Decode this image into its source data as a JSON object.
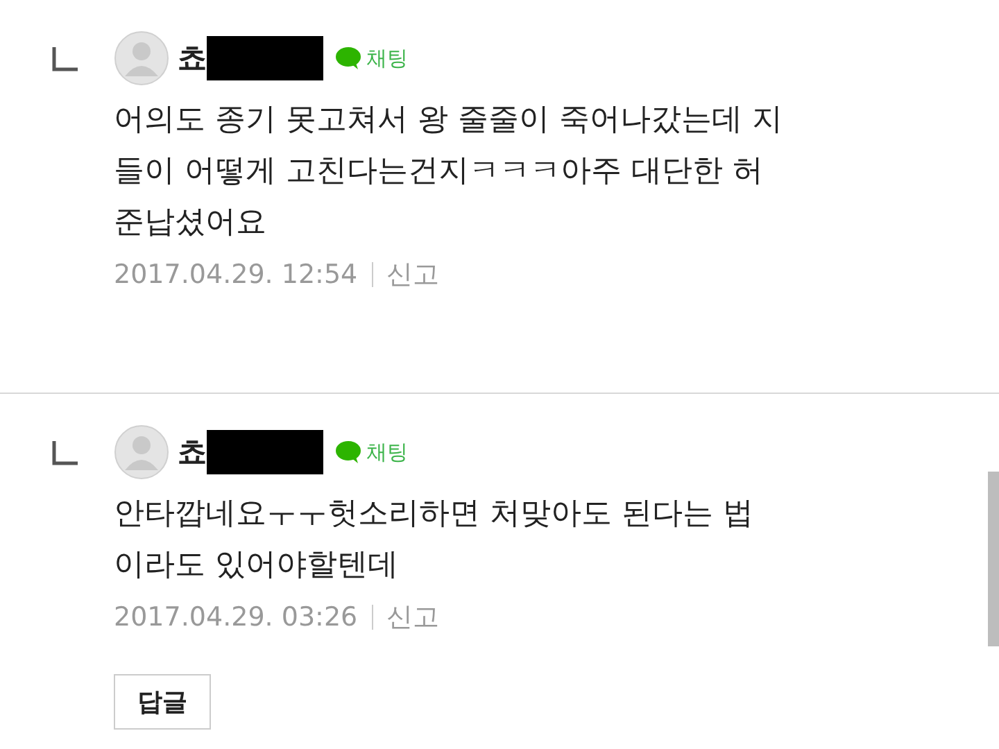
{
  "comments": [
    {
      "name": "쵸",
      "name_redacted": true,
      "chat_label": "채팅",
      "body_lines": [
        "어의도 종기 못고쳐서 왕 줄줄이 죽어나갔는데 지",
        "들이 어떻게 고친다는건지ㅋㅋㅋ아주 대단한 허",
        "준납셨어요"
      ],
      "date": "2017.04.29. 12:54",
      "report": "신고"
    },
    {
      "name": "쵸",
      "name_redacted": true,
      "chat_label": "채팅",
      "body_lines": [
        "안타깝네요ㅜㅜ헛소리하면 처맞아도 된다는 법",
        "이라도 있어야할텐데"
      ],
      "date": "2017.04.29. 03:26",
      "report": "신고",
      "reply_button": "답글"
    }
  ]
}
